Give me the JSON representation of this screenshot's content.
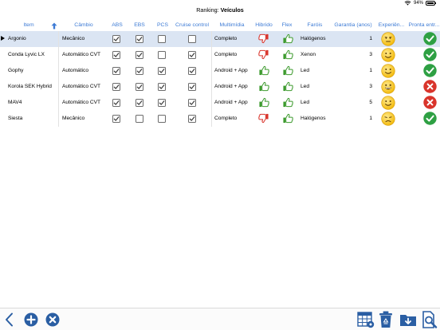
{
  "status": {
    "battery_text": "94%",
    "battery_level": 0.94
  },
  "title": {
    "prefix": "Ranking: ",
    "name": "Veículos"
  },
  "columns": {
    "item": "Item",
    "cambio": "Câmbio",
    "abs": "ABS",
    "ebs": "EBS",
    "pcs": "PCS",
    "cruise": "Cruise control",
    "multimidia": "Multimídia",
    "hibrido": "Hibrido",
    "flex": "Flex",
    "farois": "Faróis",
    "garantia": "Garantia (anos)",
    "experiencia": "Experiên...",
    "pronta": "Pronta entr..."
  },
  "icons": {
    "sort": "arrow-up-icon",
    "thumb_up": "thumbs-up-icon",
    "thumb_down": "thumbs-down-icon",
    "ok": "checkmark-circle-icon",
    "no": "x-circle-icon"
  },
  "colors": {
    "header_text": "#3d7bd5",
    "selected_row": "#dbe5f3",
    "thumb_up": "#3e9b2f",
    "thumb_down": "#d9342b",
    "ok": "#2ea043",
    "no": "#d9342b",
    "toolbar_icon": "#2a5ea3"
  },
  "rows": [
    {
      "item": "Argonio",
      "cambio": "Mecânico",
      "abs": true,
      "ebs": true,
      "pcs": false,
      "cruise": false,
      "multimidia": "Completo",
      "hibrido": "down",
      "flex": "up",
      "farois": "Halógenos",
      "garantia": "1",
      "experiencia": "neutral",
      "pronta": "ok"
    },
    {
      "item": "Conda Lyvic LX",
      "cambio": "Automático CVT",
      "abs": true,
      "ebs": true,
      "pcs": false,
      "cruise": true,
      "multimidia": "Completo",
      "hibrido": "down",
      "flex": "up",
      "farois": "Xenon",
      "garantia": "3",
      "experiencia": "happy",
      "pronta": "ok"
    },
    {
      "item": "Gophy",
      "cambio": "Automático",
      "abs": true,
      "ebs": true,
      "pcs": true,
      "cruise": true,
      "multimidia": "Android + App",
      "hibrido": "up",
      "flex": "up",
      "farois": "Led",
      "garantia": "1",
      "experiencia": "happy",
      "pronta": "ok"
    },
    {
      "item": "Korola SEK Hybrid",
      "cambio": "Automático CVT",
      "abs": true,
      "ebs": true,
      "pcs": true,
      "cruise": true,
      "multimidia": "Android + App",
      "hibrido": "up",
      "flex": "up",
      "farois": "Led",
      "garantia": "3",
      "experiencia": "grin",
      "pronta": "no"
    },
    {
      "item": "MAV4",
      "cambio": "Automático CVT",
      "abs": true,
      "ebs": true,
      "pcs": true,
      "cruise": true,
      "multimidia": "Android + App",
      "hibrido": "up",
      "flex": "up",
      "farois": "Led",
      "garantia": "5",
      "experiencia": "happy",
      "pronta": "no"
    },
    {
      "item": "Siesta",
      "cambio": "Mecânico",
      "abs": true,
      "ebs": false,
      "pcs": false,
      "cruise": true,
      "multimidia": "Completo",
      "hibrido": "down",
      "flex": "up",
      "farois": "Halógenos",
      "garantia": "1",
      "experiencia": "sad",
      "pronta": "ok"
    }
  ],
  "toolbar": {
    "back": "chevron-left-icon",
    "add": "plus-circle-icon",
    "remove": "x-circle-icon",
    "grid": "table-settings-icon",
    "trash": "recycle-trash-icon",
    "export": "folder-download-icon",
    "search": "document-search-icon"
  }
}
